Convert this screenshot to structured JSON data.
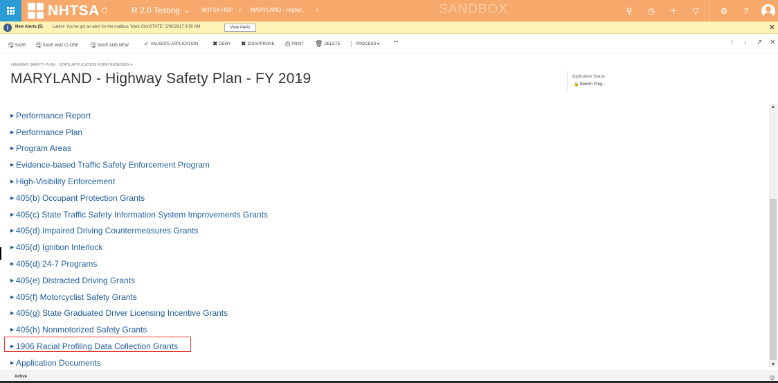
{
  "topbar": {
    "logo_text": "NHTSA",
    "app_name": "R 2.0 Testing",
    "breadcrumb": [
      "NHTSA HSP",
      "MARYLAND - Highw..."
    ],
    "environment_label": "SANDBOX",
    "bg_color": "#f7a96c",
    "icons": [
      "apps-icon",
      "home-icon",
      "search-icon",
      "history-icon",
      "plus-icon",
      "filter-icon",
      "gear-icon",
      "help-icon",
      "user-icon"
    ]
  },
  "alert": {
    "title": "New Alerts (5)",
    "message": "Latest: You've got an alert for the mailbox 'Mark ChinSTATE': 5/30/2017 9:50 AM",
    "view_button": "View Alerts"
  },
  "commands": {
    "save": "SAVE",
    "save_close": "SAVE AND CLOSE",
    "save_new": "SAVE AND NEW",
    "validate": "VALIDATE APPLICATION",
    "deny": "DENY",
    "disapprove": "DISAPPROVE",
    "print": "PRINT",
    "delete": "DELETE",
    "process": "PROCESS",
    "more": "•••"
  },
  "header": {
    "form_name": "HIGHWAY SAFETY PLAN - STATE APPLICATION FORM REDESIGN",
    "title": "MARYLAND - Highway Safety Plan - FY 2019",
    "status_label": "Application Status",
    "status_value": "New/In Prog..."
  },
  "sections": [
    "Performance Report",
    "Performance Plan",
    "Program Areas",
    "Evidence-based Traffic Safety Enforcement Program",
    "High-Visibility Enforcement",
    "405(b) Occupant Protection Grants",
    "405(c) State Traffic Safety Information System Improvements Grants",
    "405(d) Impaired Driving Countermeasures Grants",
    "405(d) Ignition Interlock",
    "405(d) 24-7 Programs",
    "405(e) Distracted Driving Grants",
    "405(f) Motorcyclist Safety Grants",
    "405(g) State Graduated Driver Licensing Incentive Grants",
    "405(h) Nonmotorized Safety Grants",
    "1906 Racial Profiling Data Collection Grants",
    "Application Documents"
  ],
  "footer": {
    "status": "Active"
  }
}
